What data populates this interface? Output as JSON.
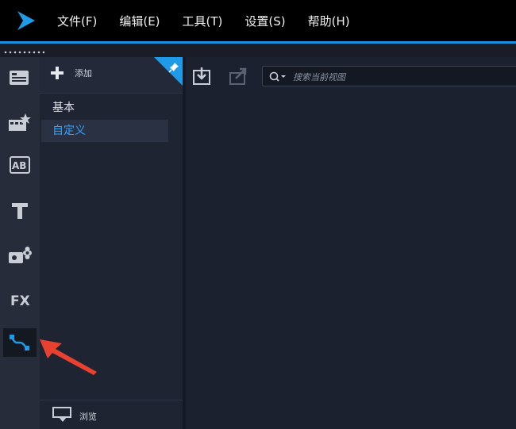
{
  "menu": {
    "items": [
      "文件(F)",
      "编辑(E)",
      "工具(T)",
      "设置(S)",
      "帮助(H)"
    ]
  },
  "rail": {
    "icons": [
      "media-icon",
      "instant-project-icon",
      "transition-icon",
      "title-icon",
      "graphics-icon",
      "filter-icon",
      "motion-path-icon"
    ],
    "labels": {
      "ab": "AB",
      "fx": "FX"
    }
  },
  "library": {
    "add_label": "添加",
    "items": [
      "基本",
      "自定义"
    ],
    "active_index": 1,
    "browse_label": "浏览"
  },
  "toolbar": {
    "search_placeholder": "搜索当前视图"
  },
  "colors": {
    "accent": "#1e90e0",
    "active_text": "#2fa4ff",
    "arrow": "#e8412f"
  }
}
